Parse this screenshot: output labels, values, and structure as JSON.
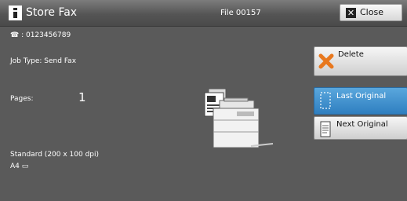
{
  "title": "Store Fax",
  "file_name": "File 00157",
  "close_label": "Close",
  "phone": "☎ : 0123456789",
  "job_type": "Job Type: Send Fax",
  "pages_label": "Pages:",
  "pages_value": "1",
  "resolution": "Standard (200 x 100 dpi)",
  "paper_size": "A4 ▭",
  "delete_label": "Delete",
  "last_original_label": "Last Original",
  "next_original_label": "Next Original",
  "colors": {
    "accent_blue": "#3a8ed0",
    "delete_x": "#e8781e"
  }
}
